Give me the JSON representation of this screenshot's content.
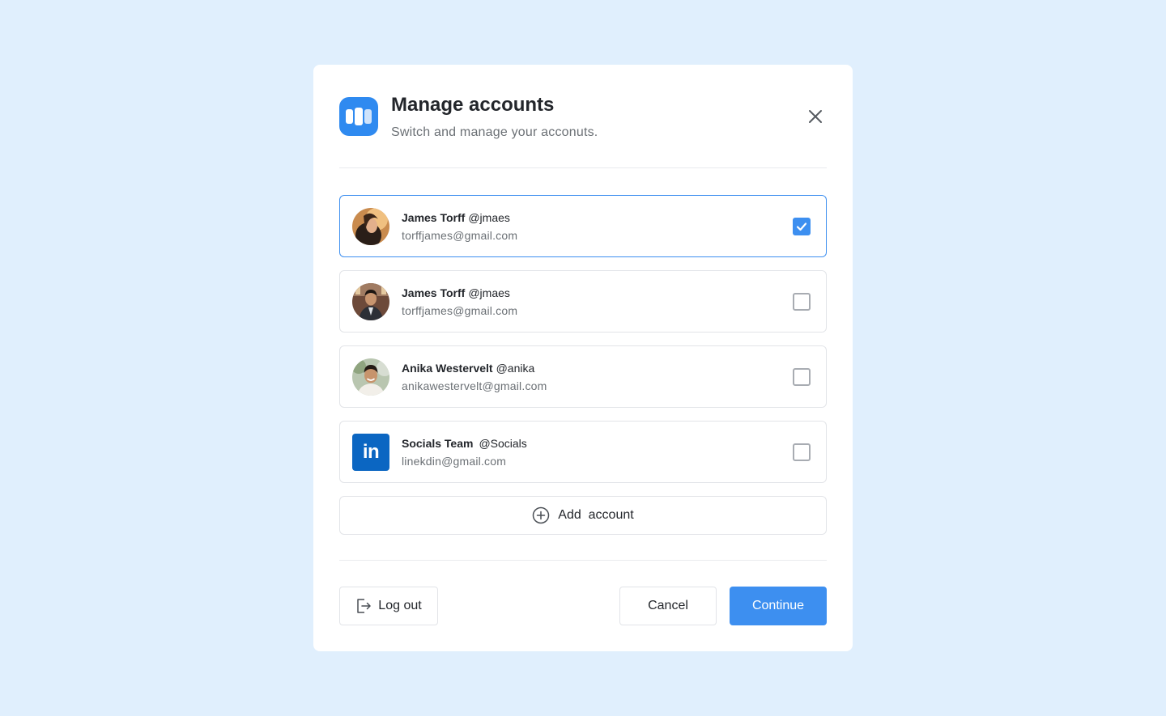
{
  "modal": {
    "title": "Manage accounts",
    "subtitle": "Switch and manage your acconuts."
  },
  "accounts": [
    {
      "name": "James Torff",
      "handle": "@jmaes",
      "email": "torffjames@gmail.com",
      "selected": true,
      "avatar": "photo-woman"
    },
    {
      "name": "James Torff",
      "handle": "@jmaes",
      "email": "torffjames@gmail.com",
      "selected": false,
      "avatar": "photo-man-suit"
    },
    {
      "name": "Anika Westervelt",
      "handle": "@anika",
      "email": "anikawestervelt@gmail.com",
      "selected": false,
      "avatar": "photo-man-smiling"
    },
    {
      "name": "Socials Team",
      "handle": "@Socials",
      "email": "linekdin@gmail.com",
      "selected": false,
      "avatar": "linkedin-logo",
      "logo_text": "in"
    }
  ],
  "add_account": {
    "label": "Add  account"
  },
  "footer": {
    "logout_label": "Log out",
    "cancel_label": "Cancel",
    "continue_label": "Continue"
  },
  "colors": {
    "background": "#e0effd",
    "accent": "#3d8ff0",
    "linkedin": "#0b66c2"
  }
}
